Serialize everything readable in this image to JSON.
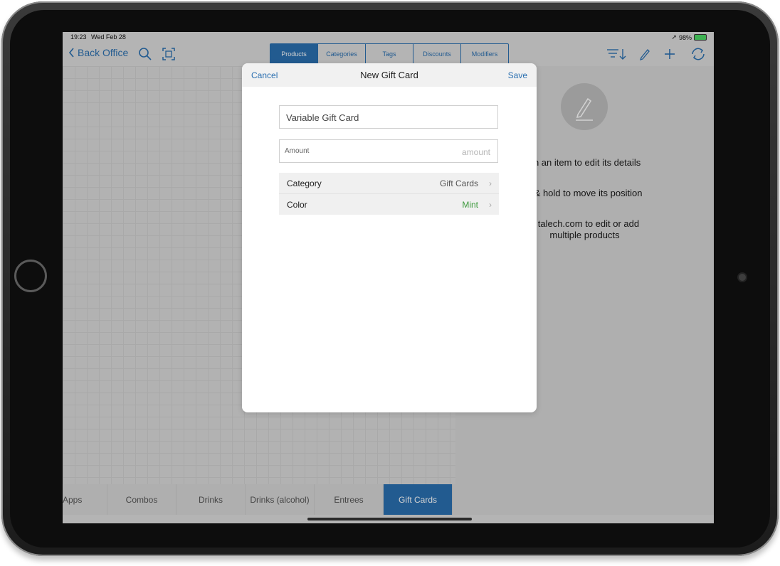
{
  "status_bar": {
    "time": "19:23",
    "date": "Wed Feb 28",
    "battery": "98%"
  },
  "nav": {
    "back_label": "Back Office",
    "tabs": [
      {
        "label": "Products",
        "active": true
      },
      {
        "label": "Categories",
        "active": false
      },
      {
        "label": "Tags",
        "active": false
      },
      {
        "label": "Discounts",
        "active": false
      },
      {
        "label": "Modifiers",
        "active": false
      }
    ],
    "icons": [
      "search-icon",
      "barcode-scan-icon",
      "sort-icon",
      "edit-icon",
      "add-icon",
      "sync-icon"
    ]
  },
  "right_panel": {
    "hint_1": "on an item to edit its details",
    "hint_2": "s & hold to move its position",
    "hint_3_line1": "e talech.com to edit or add",
    "hint_3_line2": "multiple products"
  },
  "categories": [
    {
      "label": "Apps",
      "active": false
    },
    {
      "label": "Combos",
      "active": false
    },
    {
      "label": "Drinks",
      "active": false
    },
    {
      "label": "Drinks (alcohol)",
      "active": false
    },
    {
      "label": "Entrees",
      "active": false
    },
    {
      "label": "Gift Cards",
      "active": true
    }
  ],
  "modal": {
    "cancel_label": "Cancel",
    "title": "New Gift Card",
    "save_label": "Save",
    "name_value": "Variable Gift Card",
    "amount_label": "Amount",
    "amount_placeholder": "amount",
    "rows": [
      {
        "label": "Category",
        "value": "Gift Cards"
      },
      {
        "label": "Color",
        "value": "Mint",
        "value_color": "#3e9a3e"
      }
    ]
  },
  "colors": {
    "accent": "#2a6fb0",
    "mint": "#3e9a3e"
  }
}
